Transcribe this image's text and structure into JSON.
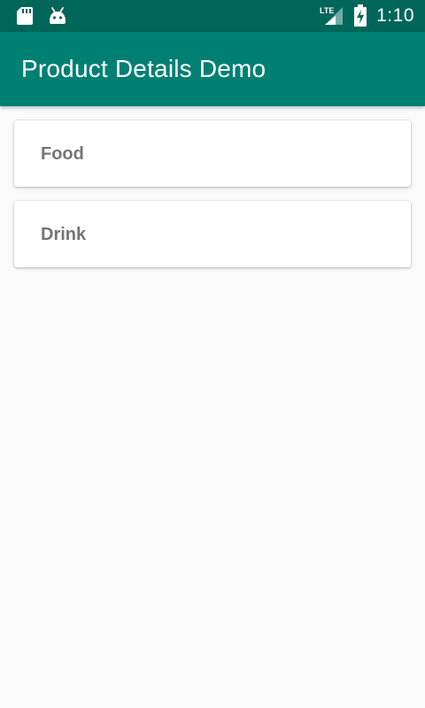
{
  "status_bar": {
    "network_type": "LTE",
    "time": "1:10"
  },
  "app_bar": {
    "title": "Product Details Demo"
  },
  "categories": [
    {
      "label": "Food"
    },
    {
      "label": "Drink"
    }
  ],
  "colors": {
    "status_bar": "#00665a",
    "app_bar": "#008073",
    "background": "#fafafa",
    "card": "#ffffff",
    "card_text": "#757575"
  }
}
